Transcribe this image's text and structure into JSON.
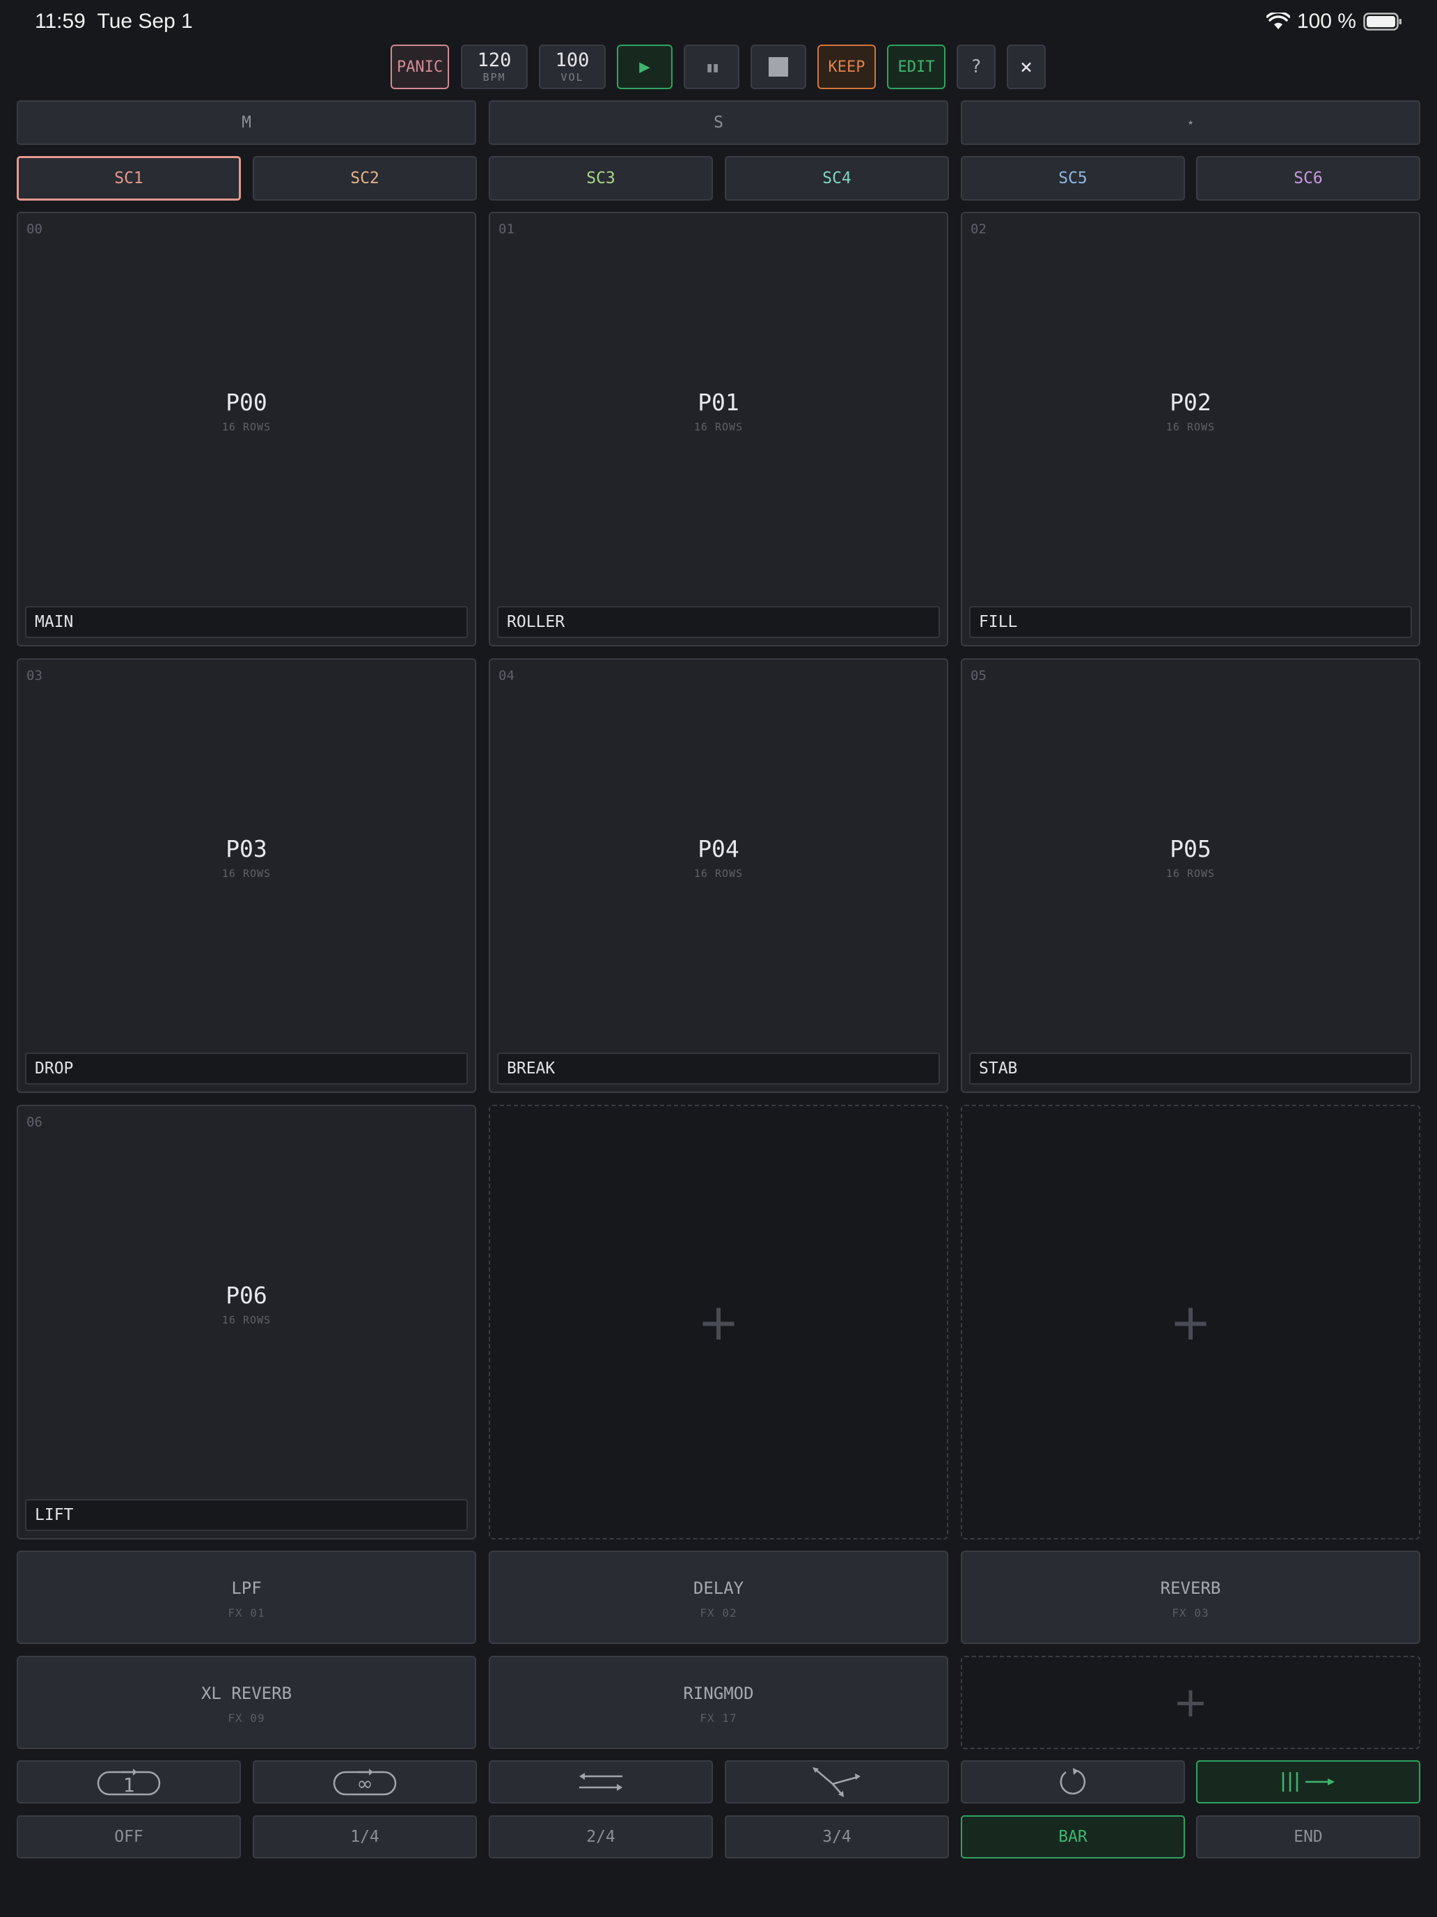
{
  "status": {
    "time": "11:59",
    "date": "Tue Sep 1",
    "battery": "100 %"
  },
  "transport": {
    "panic": "PANIC",
    "bpm_value": "120",
    "bpm_label": "BPM",
    "vol_value": "100",
    "vol_label": "VOL",
    "play_icon": "▶",
    "pause_icon": "▮▮",
    "stop_icon": "■",
    "keep": "KEEP",
    "edit": "EDIT",
    "help": "?",
    "close": "×"
  },
  "modes": [
    "M",
    "S",
    "⋆"
  ],
  "scenes": [
    {
      "label": "SC1",
      "color": "#e39a8e"
    },
    {
      "label": "SC2",
      "color": "#e3b28a"
    },
    {
      "label": "SC3",
      "color": "#a8d88a"
    },
    {
      "label": "SC4",
      "color": "#7fd6c0"
    },
    {
      "label": "SC5",
      "color": "#8db7e3"
    },
    {
      "label": "SC6",
      "color": "#c89ae0"
    }
  ],
  "patterns": [
    {
      "index": "00",
      "name": "P00",
      "rows": "16 ROWS",
      "label": "MAIN"
    },
    {
      "index": "01",
      "name": "P01",
      "rows": "16 ROWS",
      "label": "ROLLER"
    },
    {
      "index": "02",
      "name": "P02",
      "rows": "16 ROWS",
      "label": "FILL"
    },
    {
      "index": "03",
      "name": "P03",
      "rows": "16 ROWS",
      "label": "DROP"
    },
    {
      "index": "04",
      "name": "P04",
      "rows": "16 ROWS",
      "label": "BREAK"
    },
    {
      "index": "05",
      "name": "P05",
      "rows": "16 ROWS",
      "label": "STAB"
    },
    {
      "index": "06",
      "name": "P06",
      "rows": "16 ROWS",
      "label": "LIFT"
    }
  ],
  "add_glyph": "+",
  "effects": [
    {
      "name": "LPF",
      "id": "FX 01"
    },
    {
      "name": "DELAY",
      "id": "FX 02"
    },
    {
      "name": "REVERB",
      "id": "FX 03"
    },
    {
      "name": "XL REVERB",
      "id": "FX 09"
    },
    {
      "name": "RINGMOD",
      "id": "FX 17"
    }
  ],
  "playmodes": {
    "once_digit": "1",
    "loop_symbol": "∞",
    "icons": [
      "play-once-icon",
      "loop-icon",
      "ping-pong-icon",
      "random-icon",
      "retrigger-icon",
      "continue-icon"
    ],
    "selected_index": 5
  },
  "quantize": {
    "options": [
      "OFF",
      "1/4",
      "2/4",
      "3/4",
      "BAR",
      "END"
    ],
    "selected": "BAR"
  },
  "colors": {
    "accent_green": "#2fa35f",
    "panic": "#d48a95",
    "keep": "#d4743a"
  }
}
